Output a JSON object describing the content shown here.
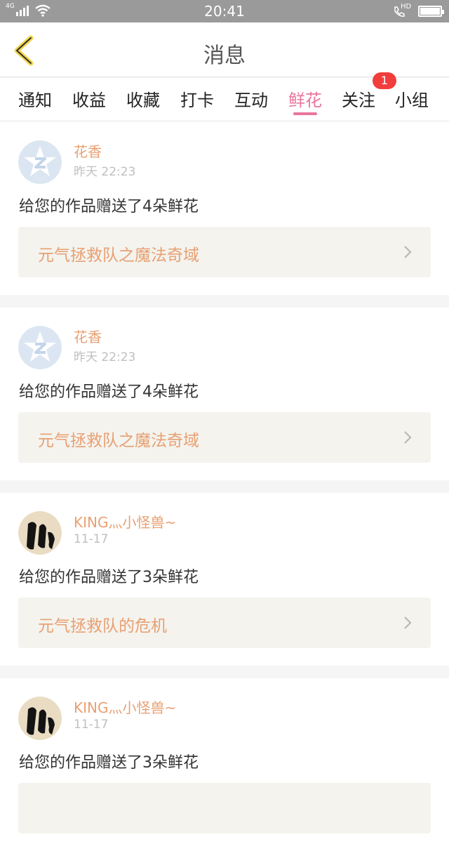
{
  "status_bar": {
    "network": "4G",
    "time": "20:41",
    "hd_label": "HD"
  },
  "nav": {
    "title": "消息"
  },
  "tabs": [
    {
      "label": "通知",
      "active": false
    },
    {
      "label": "收益",
      "active": false
    },
    {
      "label": "收藏",
      "active": false
    },
    {
      "label": "打卡",
      "active": false
    },
    {
      "label": "互动",
      "active": false
    },
    {
      "label": "鲜花",
      "active": true
    },
    {
      "label": "关注",
      "active": false,
      "badge": "1"
    },
    {
      "label": "小组",
      "active": false
    }
  ],
  "messages": [
    {
      "user": "花香",
      "time": "昨天 22:23",
      "text": "给您的作品赠送了4朵鲜花",
      "work": "元气拯救队之魔法奇域",
      "avatar": "default-avatar-icon"
    },
    {
      "user": "花香",
      "time": "昨天 22:23",
      "text": "给您的作品赠送了4朵鲜花",
      "work": "元气拯救队之魔法奇域",
      "avatar": "default-avatar-icon"
    },
    {
      "user": "KING灬小怪兽~",
      "time": "11-17",
      "text": "给您的作品赠送了3朵鲜花",
      "work": "元气拯救队的危机",
      "avatar": "user-photo-avatar"
    },
    {
      "user": "KING灬小怪兽~",
      "time": "11-17",
      "text": "给您的作品赠送了3朵鲜花",
      "work": "",
      "avatar": "user-photo-avatar"
    }
  ],
  "colors": {
    "accent": "#e8769b",
    "orange_text": "#e8a073",
    "badge": "#f23d3d",
    "back_arrow": "#f2d64b"
  }
}
